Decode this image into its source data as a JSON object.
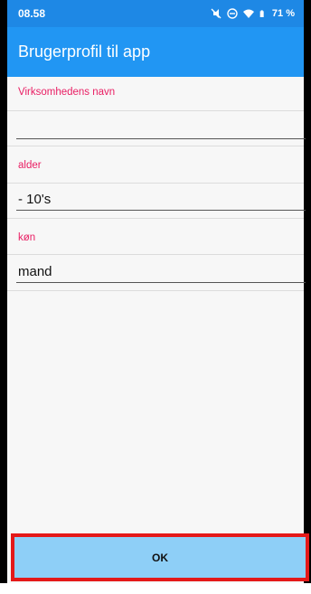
{
  "status_bar": {
    "time": "08.58",
    "battery": "71 %"
  },
  "app_bar": {
    "title": "Brugerprofil til app"
  },
  "form": {
    "company_label": "Virksomhedens navn",
    "company_value": "",
    "age_label": "alder",
    "age_value": "- 10's",
    "gender_label": "køn",
    "gender_value": "mand"
  },
  "actions": {
    "ok_label": "OK"
  },
  "colors": {
    "status_bar": "#1e88e5",
    "app_bar": "#2196f3",
    "label_accent": "#e91e63",
    "button_bg": "#8ecff7",
    "highlight_border": "#e41919"
  }
}
